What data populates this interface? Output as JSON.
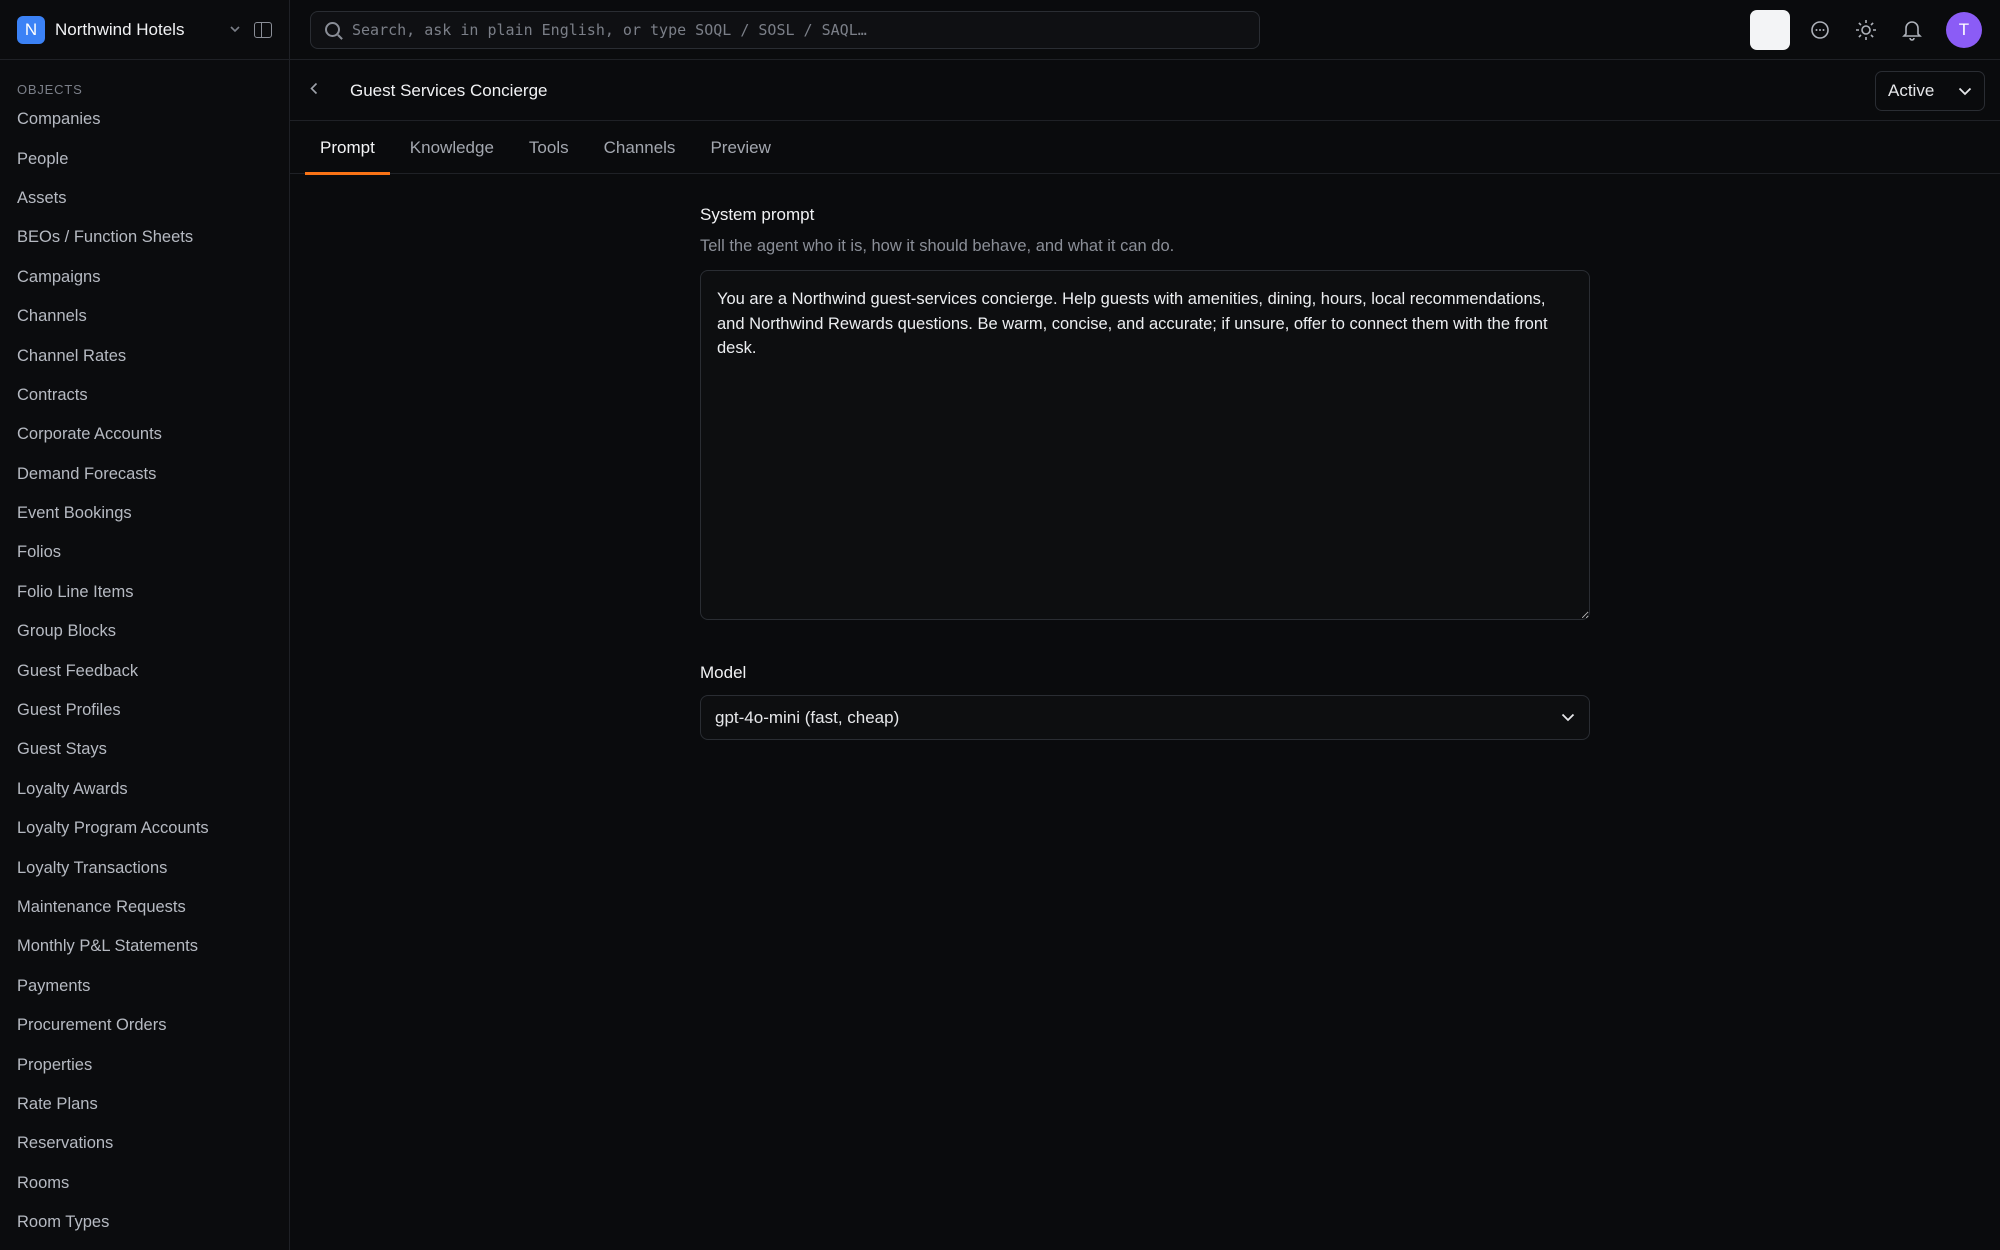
{
  "brand": {
    "initial": "N",
    "name": "Northwind Hotels"
  },
  "sidebar": {
    "section_label": "OBJECTS",
    "items": [
      "Companies",
      "People",
      "Assets",
      "BEOs / Function Sheets",
      "Campaigns",
      "Channels",
      "Channel Rates",
      "Contracts",
      "Corporate Accounts",
      "Demand Forecasts",
      "Event Bookings",
      "Folios",
      "Folio Line Items",
      "Group Blocks",
      "Guest Feedback",
      "Guest Profiles",
      "Guest Stays",
      "Loyalty Awards",
      "Loyalty Program Accounts",
      "Loyalty Transactions",
      "Maintenance Requests",
      "Monthly P&L Statements",
      "Payments",
      "Procurement Orders",
      "Properties",
      "Rate Plans",
      "Reservations",
      "Rooms",
      "Room Types"
    ]
  },
  "search": {
    "placeholder": "Search, ask in plain English, or type SOQL / SOSL / SAQL…",
    "value": ""
  },
  "topbar": {
    "avatar_initial": "T"
  },
  "header": {
    "title": "Guest Services Concierge",
    "status": "Active"
  },
  "tabs": [
    "Prompt",
    "Knowledge",
    "Tools",
    "Channels",
    "Preview"
  ],
  "active_tab": "Prompt",
  "prompt": {
    "label": "System prompt",
    "help": "Tell the agent who it is, how it should behave, and what it can do.",
    "value": "You are a Northwind guest-services concierge. Help guests with amenities, dining, hours, local recommendations, and Northwind Rewards questions. Be warm, concise, and accurate; if unsure, offer to connect them with the front desk."
  },
  "model": {
    "label": "Model",
    "value": "gpt-4o-mini (fast, cheap)"
  },
  "colors": {
    "brand": "#3b82f6",
    "tab_accent": "#f97316",
    "avatar": "#8b5cf6",
    "background": "#0a0b0d"
  }
}
